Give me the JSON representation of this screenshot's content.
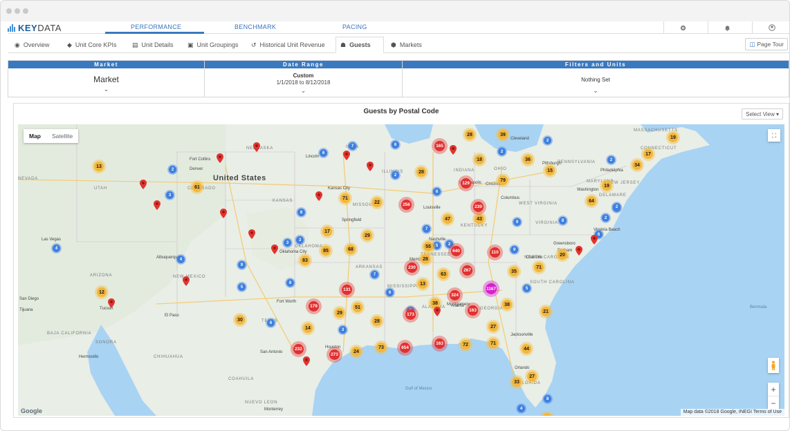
{
  "app": {
    "brand_light": "KEY",
    "brand_bold": "DATA",
    "accent": "#3a79bf"
  },
  "topnav": {
    "tabs": [
      {
        "label": "PERFORMANCE",
        "active": true
      },
      {
        "label": "BENCHMARK",
        "active": false
      },
      {
        "label": "PACING",
        "active": false
      }
    ],
    "icons": [
      "gear-icon",
      "bell-icon",
      "user-icon"
    ]
  },
  "subnav": {
    "tabs": [
      {
        "label": "Overview",
        "icon": "eye-icon"
      },
      {
        "label": "Unit Core KPIs",
        "icon": "tag-icon"
      },
      {
        "label": "Unit Details",
        "icon": "building-icon"
      },
      {
        "label": "Unit Groupings",
        "icon": "image-icon"
      },
      {
        "label": "Historical Unit Revenue",
        "icon": "history-icon"
      },
      {
        "label": "Guests",
        "icon": "users-icon",
        "active": true
      },
      {
        "label": "Markets",
        "icon": "map-marker-icon"
      }
    ],
    "page_tour": "Page Tour"
  },
  "filters": {
    "market": {
      "header": "Market",
      "value": "Market"
    },
    "date_range": {
      "header": "Date Range",
      "value": "Custom",
      "sub": "1/1/2018 to 8/12/2018"
    },
    "filters_units": {
      "header": "Filters and Units",
      "value": "Nothing Set"
    }
  },
  "map_panel": {
    "title": "Guests by Postal Code",
    "select_view": "Select View ▾",
    "toggle_map": "Map",
    "toggle_satellite": "Satellite",
    "credit": "Map data ©2018 Google, INEGI   Terms of Use",
    "google": "Google",
    "country_label": "United States",
    "state_labels": [
      {
        "t": "NEBRASKA"
      },
      {
        "t": "UTAH"
      },
      {
        "t": "COLORADO"
      },
      {
        "t": "KANSAS"
      },
      {
        "t": "MISSOURI"
      },
      {
        "t": "OKLAHOMA"
      },
      {
        "t": "NEW MEXICO"
      },
      {
        "t": "ARIZONA"
      },
      {
        "t": "TEXAS"
      },
      {
        "t": "ARKANSAS"
      },
      {
        "t": "MISSISSIPPI"
      },
      {
        "t": "ALABAMA"
      },
      {
        "t": "GEORGIA"
      },
      {
        "t": "TENNESSEE"
      },
      {
        "t": "KENTUCKY"
      },
      {
        "t": "VIRGINIA"
      },
      {
        "t": "WEST VIRGINIA"
      },
      {
        "t": "NORTH CAROLINA"
      },
      {
        "t": "SOUTH CAROLINA"
      },
      {
        "t": "OHIO"
      },
      {
        "t": "INDIANA"
      },
      {
        "t": "ILLINOIS"
      },
      {
        "t": "PENNSYLVANIA"
      },
      {
        "t": "NEW JERSEY"
      },
      {
        "t": "MARYLAND"
      },
      {
        "t": "DELAWARE"
      },
      {
        "t": "CONNECTICUT"
      },
      {
        "t": "MASSACHUSETTS"
      },
      {
        "t": "FLORIDA"
      },
      {
        "t": "NEVADA"
      },
      {
        "t": "IOWA"
      },
      {
        "t": "SONORA"
      },
      {
        "t": "CHIHUAHUA"
      },
      {
        "t": "COAHUILA"
      },
      {
        "t": "NUEVO LEON"
      },
      {
        "t": "BAJA CALIFORNIA"
      }
    ],
    "city_labels": [
      {
        "t": "Las Vegas"
      },
      {
        "t": "Denver"
      },
      {
        "t": "Albuquerque"
      },
      {
        "t": "Tucson"
      },
      {
        "t": "El Paso"
      },
      {
        "t": "Kansas City"
      },
      {
        "t": "Oklahoma City"
      },
      {
        "t": "Fort Worth"
      },
      {
        "t": "San Antonio"
      },
      {
        "t": "Houston"
      },
      {
        "t": "Nashville"
      },
      {
        "t": "Indianapolis"
      },
      {
        "t": "Cincinnati"
      },
      {
        "t": "Columbus"
      },
      {
        "t": "Cleveland"
      },
      {
        "t": "Pittsburgh"
      },
      {
        "t": "Philadelphia"
      },
      {
        "t": "Washington"
      },
      {
        "t": "Charlotte"
      },
      {
        "t": "Jacksonville"
      },
      {
        "t": "Orlando"
      },
      {
        "t": "Monterrey"
      },
      {
        "t": "Hermosillo"
      },
      {
        "t": "Tijuana"
      },
      {
        "t": "San Diego"
      },
      {
        "t": "Louisville"
      },
      {
        "t": "Lincoln"
      },
      {
        "t": "Springfield"
      },
      {
        "t": "Fort Collins"
      },
      {
        "t": "Memphis"
      },
      {
        "t": "Atlanta"
      },
      {
        "t": "Montgomery"
      },
      {
        "t": "Greensboro"
      },
      {
        "t": "Durham"
      },
      {
        "t": "Virginia Beach"
      }
    ],
    "water_labels": [
      {
        "t": "Bermuda"
      },
      {
        "t": "Gulf of Mexico"
      }
    ],
    "clusters": [
      {
        "n": "13",
        "c": "yellow"
      },
      {
        "n": "2",
        "c": "blue"
      },
      {
        "n": "61",
        "c": "yellow"
      },
      {
        "n": "3",
        "c": "blue"
      },
      {
        "n": "4",
        "c": "blue"
      },
      {
        "n": "4",
        "c": "blue"
      },
      {
        "n": "12",
        "c": "yellow"
      },
      {
        "n": "9",
        "c": "blue"
      },
      {
        "n": "5",
        "c": "blue"
      },
      {
        "n": "6",
        "c": "blue"
      },
      {
        "n": "7",
        "c": "blue"
      },
      {
        "n": "6",
        "c": "blue"
      },
      {
        "n": "3",
        "c": "blue"
      },
      {
        "n": "71",
        "c": "yellow"
      },
      {
        "n": "22",
        "c": "yellow"
      },
      {
        "n": "8",
        "c": "blue"
      },
      {
        "n": "17",
        "c": "yellow"
      },
      {
        "n": "29",
        "c": "yellow"
      },
      {
        "n": "3",
        "c": "blue"
      },
      {
        "n": "85",
        "c": "yellow"
      },
      {
        "n": "68",
        "c": "yellow"
      },
      {
        "n": "83",
        "c": "yellow"
      },
      {
        "n": "8",
        "c": "blue"
      },
      {
        "n": "30",
        "c": "yellow"
      },
      {
        "n": "6",
        "c": "blue"
      },
      {
        "n": "14",
        "c": "yellow"
      },
      {
        "n": "3",
        "c": "blue"
      },
      {
        "n": "179",
        "c": "red"
      },
      {
        "n": "29",
        "c": "yellow"
      },
      {
        "n": "51",
        "c": "yellow"
      },
      {
        "n": "28",
        "c": "yellow"
      },
      {
        "n": "232",
        "c": "red"
      },
      {
        "n": "273",
        "c": "red"
      },
      {
        "n": "24",
        "c": "yellow"
      },
      {
        "n": "73",
        "c": "yellow"
      },
      {
        "n": "654",
        "c": "red"
      },
      {
        "n": "6",
        "c": "blue"
      },
      {
        "n": "131",
        "c": "red"
      },
      {
        "n": "7",
        "c": "blue"
      },
      {
        "n": "5",
        "c": "blue"
      },
      {
        "n": "13",
        "c": "yellow"
      },
      {
        "n": "230",
        "c": "red"
      },
      {
        "n": "173",
        "c": "red"
      },
      {
        "n": "38",
        "c": "yellow"
      },
      {
        "n": "2",
        "c": "blue"
      },
      {
        "n": "28",
        "c": "yellow"
      },
      {
        "n": "5",
        "c": "blue"
      },
      {
        "n": "256",
        "c": "red"
      },
      {
        "n": "7",
        "c": "blue"
      },
      {
        "n": "55",
        "c": "yellow"
      },
      {
        "n": "47",
        "c": "yellow"
      },
      {
        "n": "43",
        "c": "yellow"
      },
      {
        "n": "63",
        "c": "yellow"
      },
      {
        "n": "640",
        "c": "red"
      },
      {
        "n": "267",
        "c": "red"
      },
      {
        "n": "324",
        "c": "red"
      },
      {
        "n": "163",
        "c": "red"
      },
      {
        "n": "72",
        "c": "yellow"
      },
      {
        "n": "71",
        "c": "yellow"
      },
      {
        "n": "27",
        "c": "yellow"
      },
      {
        "n": "38",
        "c": "yellow"
      },
      {
        "n": "163",
        "c": "red"
      },
      {
        "n": "1167",
        "c": "magenta"
      },
      {
        "n": "35",
        "c": "yellow"
      },
      {
        "n": "110",
        "c": "red"
      },
      {
        "n": "9",
        "c": "blue"
      },
      {
        "n": "71",
        "c": "yellow"
      },
      {
        "n": "20",
        "c": "yellow"
      },
      {
        "n": "21",
        "c": "yellow"
      },
      {
        "n": "44",
        "c": "yellow"
      },
      {
        "n": "27",
        "c": "yellow"
      },
      {
        "n": "33",
        "c": "yellow"
      },
      {
        "n": "4",
        "c": "blue"
      },
      {
        "n": "24",
        "c": "yellow"
      },
      {
        "n": "5",
        "c": "blue"
      },
      {
        "n": "8",
        "c": "blue"
      },
      {
        "n": "9",
        "c": "blue"
      },
      {
        "n": "8",
        "c": "blue"
      },
      {
        "n": "6",
        "c": "blue"
      },
      {
        "n": "2",
        "c": "blue"
      },
      {
        "n": "5",
        "c": "blue"
      },
      {
        "n": "239",
        "c": "red"
      },
      {
        "n": "129",
        "c": "red"
      },
      {
        "n": "79",
        "c": "yellow"
      },
      {
        "n": "18",
        "c": "yellow"
      },
      {
        "n": "28",
        "c": "yellow"
      },
      {
        "n": "2",
        "c": "blue"
      },
      {
        "n": "165",
        "c": "red"
      },
      {
        "n": "28",
        "c": "yellow"
      },
      {
        "n": "39",
        "c": "yellow"
      },
      {
        "n": "2",
        "c": "blue"
      },
      {
        "n": "36",
        "c": "yellow"
      },
      {
        "n": "15",
        "c": "yellow"
      },
      {
        "n": "2",
        "c": "blue"
      },
      {
        "n": "2",
        "c": "blue"
      },
      {
        "n": "34",
        "c": "yellow"
      },
      {
        "n": "17",
        "c": "yellow"
      },
      {
        "n": "19",
        "c": "yellow"
      },
      {
        "n": "19",
        "c": "yellow"
      },
      {
        "n": "64",
        "c": "yellow"
      },
      {
        "n": "2",
        "c": "blue"
      },
      {
        "n": "6",
        "c": "blue"
      }
    ]
  }
}
